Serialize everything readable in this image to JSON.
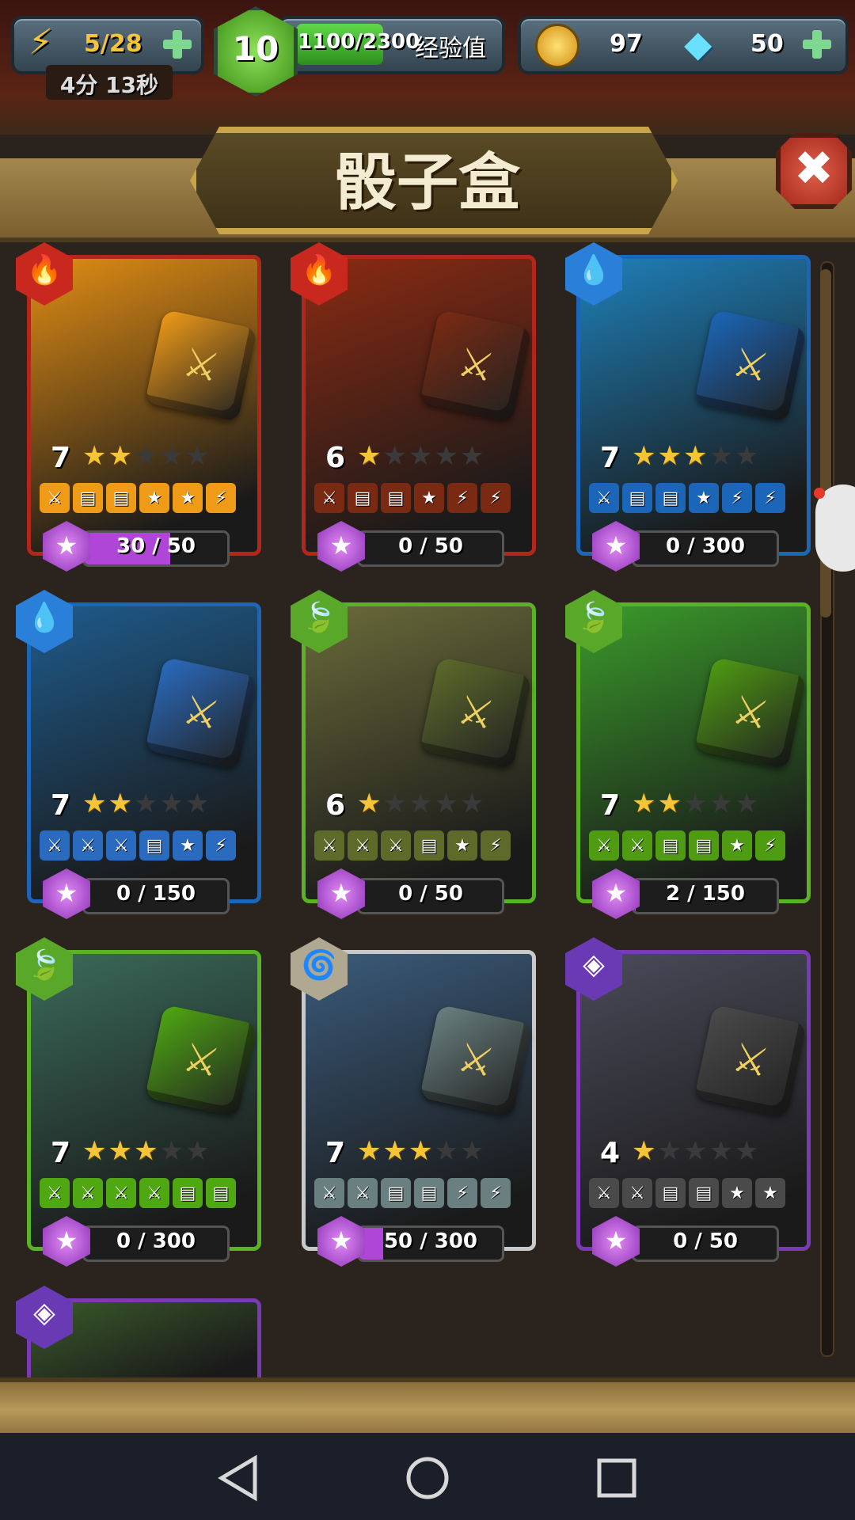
{
  "hud": {
    "energy": "5/28",
    "timer": "4分 13秒",
    "player_level": "10",
    "xp": "1100/2300",
    "xp_label": "经验值",
    "coins": "97",
    "gems": "50"
  },
  "panel": {
    "title": "骰子盒",
    "close_glyph": "✖"
  },
  "cards": [
    {
      "element": "fire",
      "element_glyph": "🔥",
      "level": "7",
      "stars": 2,
      "faces": [
        "⚔",
        "▤",
        "▤",
        "★",
        "★",
        "⚡"
      ],
      "progress": "30 / 50",
      "progress_fraction": 0.6,
      "color": "#e08c14",
      "face_color": "#f09b18",
      "border": "#b3261a"
    },
    {
      "element": "fire",
      "element_glyph": "🔥",
      "level": "6",
      "stars": 1,
      "faces": [
        "⚔",
        "▤",
        "▤",
        "★",
        "⚡",
        "⚡"
      ],
      "progress": "0 / 50",
      "progress_fraction": 0,
      "color": "#8b2a12",
      "face_color": "#7a2a12",
      "border": "#b3261a"
    },
    {
      "element": "water",
      "element_glyph": "💧",
      "level": "7",
      "stars": 3,
      "faces": [
        "⚔",
        "▤",
        "▤",
        "★",
        "⚡",
        "⚡"
      ],
      "progress": "0 / 300",
      "progress_fraction": 0,
      "color": "#1e7fb8",
      "face_color": "#1b66b8",
      "border": "#1b66b8"
    },
    {
      "element": "water",
      "element_glyph": "💧",
      "level": "7",
      "stars": 2,
      "faces": [
        "⚔",
        "⚔",
        "⚔",
        "▤",
        "★",
        "⚡"
      ],
      "progress": "0 / 150",
      "progress_fraction": 0,
      "color": "#1e5a8b",
      "face_color": "#2a6bbf",
      "border": "#1b66b8"
    },
    {
      "element": "nature",
      "element_glyph": "🍃",
      "level": "6",
      "stars": 1,
      "faces": [
        "⚔",
        "⚔",
        "⚔",
        "▤",
        "★",
        "⚡"
      ],
      "progress": "0 / 50",
      "progress_fraction": 0,
      "color": "#6a6a3a",
      "face_color": "#5d6a2a",
      "border": "#59b322"
    },
    {
      "element": "nature",
      "element_glyph": "🍃",
      "level": "7",
      "stars": 2,
      "faces": [
        "⚔",
        "⚔",
        "▤",
        "▤",
        "★",
        "⚡"
      ],
      "progress": "2 / 150",
      "progress_fraction": 0.013,
      "color": "#3a9a2a",
      "face_color": "#4f9b12",
      "border": "#59b322"
    },
    {
      "element": "nature",
      "element_glyph": "🍃",
      "level": "7",
      "stars": 3,
      "faces": [
        "⚔",
        "⚔",
        "⚔",
        "⚔",
        "▤",
        "▤"
      ],
      "progress": "0 / 300",
      "progress_fraction": 0,
      "color": "#3a6a5a",
      "face_color": "#4fa812",
      "border": "#59b322"
    },
    {
      "element": "spirit",
      "element_glyph": "🌀",
      "level": "7",
      "stars": 3,
      "faces": [
        "⚔",
        "⚔",
        "▤",
        "▤",
        "⚡",
        "⚡"
      ],
      "progress": "50 / 300",
      "progress_fraction": 0.167,
      "color": "#3a5a7a",
      "face_color": "#6a8080",
      "border": "#c9c9c9"
    },
    {
      "element": "shadow",
      "element_glyph": "◈",
      "level": "4",
      "stars": 1,
      "faces": [
        "⚔",
        "⚔",
        "▤",
        "▤",
        "★",
        "★"
      ],
      "progress": "0 / 50",
      "progress_fraction": 0,
      "color": "#4a4a5a",
      "face_color": "#4a4a4a",
      "border": "#7a3ab5"
    },
    {
      "element": "shadow",
      "element_glyph": "◈",
      "level": "",
      "stars": 0,
      "faces": [],
      "progress": "",
      "progress_fraction": 0,
      "color": "#3a5a2a",
      "face_color": "#4a4a4a",
      "border": "#7a3ab5"
    }
  ],
  "colors": {
    "fire": "#c8281e",
    "water": "#2a7fd8",
    "nature": "#5aa82a",
    "spirit": "#b0a890",
    "shadow": "#6a3ab5"
  },
  "icons": {
    "energy": "lightning-icon",
    "level": "hexagon-level-badge",
    "coin": "coin-icon",
    "gem": "diamond-icon",
    "close": "close-icon"
  }
}
